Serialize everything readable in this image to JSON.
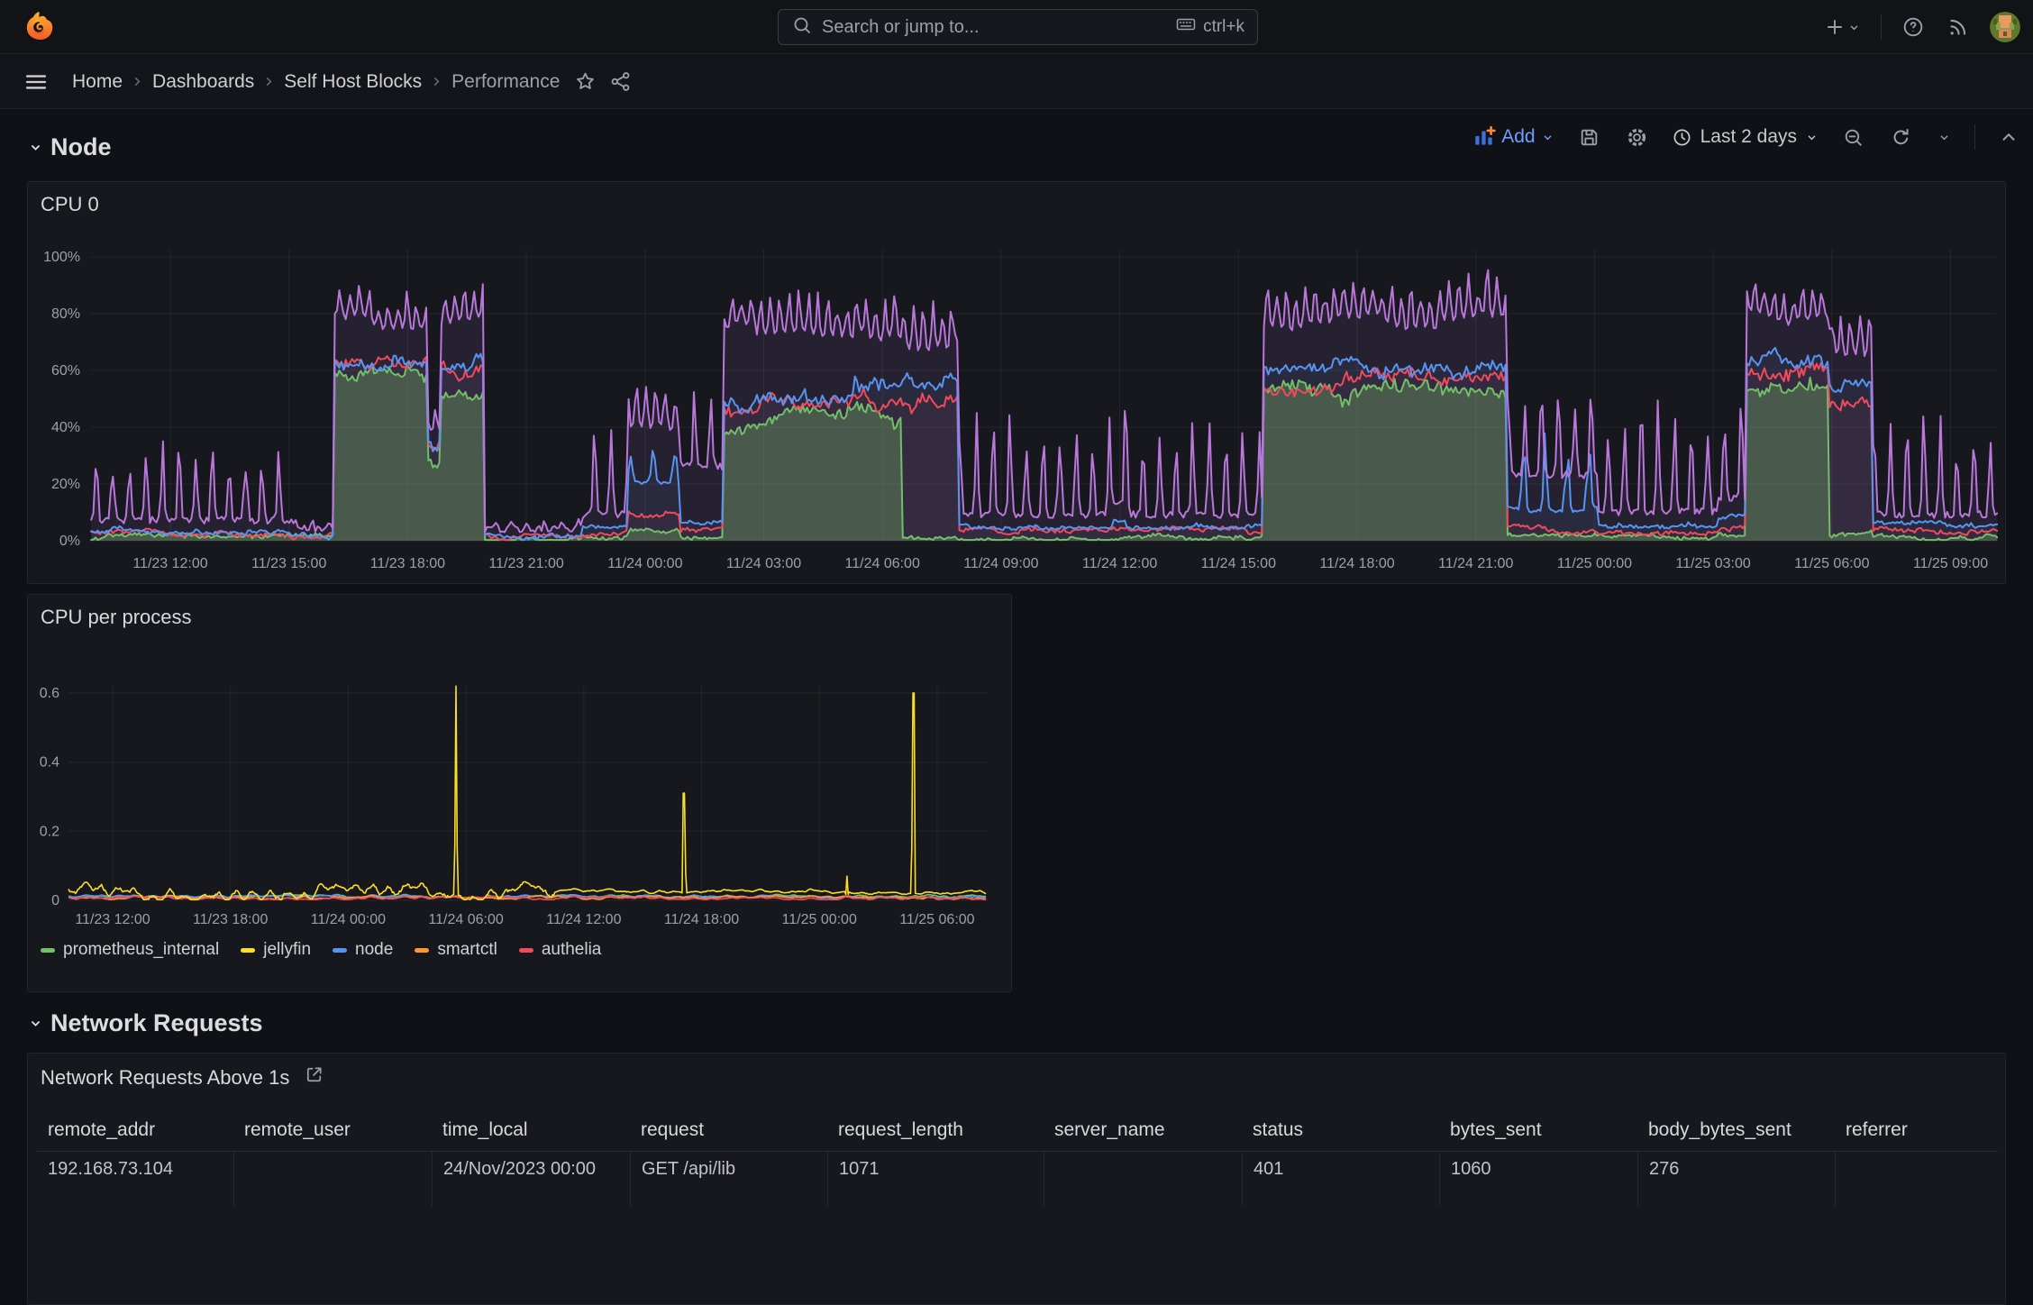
{
  "topbar": {
    "search": {
      "placeholder": "Search or jump to...",
      "shortcut": "ctrl+k"
    }
  },
  "breadcrumbs": {
    "items": [
      "Home",
      "Dashboards",
      "Self Host Blocks",
      "Performance"
    ]
  },
  "toolbar": {
    "add_label": "Add",
    "time_range": "Last 2 days"
  },
  "sections": [
    {
      "title": "Node"
    },
    {
      "title": "Network Requests"
    }
  ],
  "panels": {
    "cpu0": {
      "title": "CPU 0",
      "chart_data": {
        "type": "area",
        "unit": "percent",
        "ylim": [
          0,
          100
        ],
        "yticks": [
          "0%",
          "20%",
          "40%",
          "60%",
          "80%",
          "100%"
        ],
        "xticks": [
          "11/23 12:00",
          "11/23 15:00",
          "11/23 18:00",
          "11/23 21:00",
          "11/24 00:00",
          "11/24 03:00",
          "11/24 06:00",
          "11/24 09:00",
          "11/24 12:00",
          "11/24 15:00",
          "11/24 18:00",
          "11/24 21:00",
          "11/25 00:00",
          "11/25 03:00",
          "11/25 06:00",
          "11/25 09:00"
        ],
        "series_colors": {
          "green": "#73BF69",
          "red": "#F2495C",
          "blue": "#5794F2",
          "purple": "#B877D9"
        },
        "segments": [
          {
            "t": [
              -0.6,
              4.6
            ],
            "v": {
              "green": 1,
              "red": 2.5,
              "blue": 3.5,
              "purple": 6
            },
            "spike": 36
          },
          {
            "t": [
              4.6,
              5.65
            ],
            "v": {
              "green": 1,
              "red": 1.5,
              "blue": 2,
              "purple": 3
            },
            "spike": 6
          },
          {
            "t": [
              5.65,
              8.0
            ],
            "v": {
              "green": 57,
              "red": 60,
              "blue": 65,
              "purple": 77
            },
            "spike": 89
          },
          {
            "t": [
              8.0,
              8.35
            ],
            "v": {
              "green": 28,
              "red": 31,
              "blue": 34,
              "purple": 42
            },
            "spike": 50
          },
          {
            "t": [
              8.35,
              9.45
            ],
            "v": {
              "green": 54,
              "red": 58,
              "blue": 63,
              "purple": 79
            },
            "spike": 91
          },
          {
            "t": [
              9.45,
              11.9
            ],
            "v": {
              "green": 1,
              "red": 1.5,
              "blue": 2,
              "purple": 3
            },
            "spike": 6
          },
          {
            "t": [
              11.9,
              13.05
            ],
            "v": {
              "green": 2,
              "red": 3,
              "blue": 5,
              "purple": 8
            },
            "spike": 44
          },
          {
            "t": [
              13.05,
              14.4
            ],
            "v": {
              "green": 4,
              "red": 10,
              "blue": 20,
              "purple": 40
            },
            "spike": 58,
            "bs": 35
          },
          {
            "t": [
              14.4,
              15.5
            ],
            "v": {
              "green": 2,
              "red": 4,
              "blue": 7,
              "purple": 25
            },
            "spike": 56
          },
          {
            "t": [
              15.5,
              16.3
            ],
            "v": {
              "green": 42,
              "red": 45,
              "blue": 50,
              "purple": 77
            },
            "spike": 87
          },
          {
            "t": [
              16.3,
              18.8
            ],
            "v": {
              "green": 43,
              "red": 47,
              "blue": 53,
              "purple": 72
            },
            "spike": 88
          },
          {
            "t": [
              18.8,
              20.0
            ],
            "v": {
              "green": 44,
              "red": 50,
              "blue": 57,
              "purple": 73
            },
            "spike": 89
          },
          {
            "t": [
              20.0,
              21.4
            ],
            "v": {
              "green": 2,
              "red": 50,
              "blue": 58,
              "purple": 70
            },
            "spike": 88
          },
          {
            "t": [
              21.4,
              25.3
            ],
            "v": {
              "green": 1,
              "red": 3.5,
              "blue": 5.5,
              "purple": 8
            },
            "spike": 46
          },
          {
            "t": [
              25.3,
              25.65
            ],
            "v": {
              "green": 1,
              "red": 4,
              "blue": 7,
              "purple": 12
            },
            "spike": 80
          },
          {
            "t": [
              25.65,
              29.1
            ],
            "v": {
              "green": 1,
              "red": 3.5,
              "blue": 5.5,
              "purple": 8
            },
            "spike": 44
          },
          {
            "t": [
              29.1,
              33.6
            ],
            "v": {
              "green": 52,
              "red": 56,
              "blue": 62,
              "purple": 77
            },
            "spike": 93
          },
          {
            "t": [
              33.6,
              35.3
            ],
            "v": {
              "green": 50,
              "red": 55,
              "blue": 61,
              "purple": 79
            },
            "spike": 96
          },
          {
            "t": [
              35.3,
              37.6
            ],
            "v": {
              "green": 1,
              "red": 4,
              "blue": 12,
              "purple": 22
            },
            "spike": 58,
            "bs": 40
          },
          {
            "t": [
              37.6,
              40.6
            ],
            "v": {
              "green": 1,
              "red": 3.5,
              "blue": 6,
              "purple": 9
            },
            "spike": 50
          },
          {
            "t": [
              40.6,
              41.3
            ],
            "v": {
              "green": 2,
              "red": 5,
              "blue": 9,
              "purple": 14
            },
            "spike": 54
          },
          {
            "t": [
              41.3,
              43.4
            ],
            "v": {
              "green": 55,
              "red": 58,
              "blue": 63,
              "purple": 79
            },
            "spike": 92
          },
          {
            "t": [
              43.4,
              44.5
            ],
            "v": {
              "green": 2,
              "red": 46,
              "blue": 54,
              "purple": 68
            },
            "spike": 85
          },
          {
            "t": [
              44.5,
              48.3
            ],
            "v": {
              "green": 1,
              "red": 3.5,
              "blue": 5.5,
              "purple": 8
            },
            "spike": 48
          }
        ]
      }
    },
    "cpu_per_process": {
      "title": "CPU per process",
      "chart_data": {
        "type": "line",
        "ylim": [
          0,
          0.65
        ],
        "yticks": [
          "0",
          "0.2",
          "0.4",
          "0.6"
        ],
        "xticks": [
          "11/23 12:00",
          "11/23 18:00",
          "11/24 00:00",
          "11/24 06:00",
          "11/24 12:00",
          "11/24 18:00",
          "11/25 00:00",
          "11/25 06:00"
        ],
        "series": [
          {
            "name": "prometheus_internal",
            "color": "#73BF69",
            "base": 0.012
          },
          {
            "name": "jellyfin",
            "color": "#FADE2A",
            "base": 0.025,
            "wiggle": [
              {
                "t": [
                  -0.8,
                  24
                ],
                "amp": 0.018
              },
              {
                "t": [
                  24,
                  46
                ],
                "amp": 0.005
              }
            ],
            "spikes": [
              {
                "t": 19.0,
                "v": 0.62
              },
              {
                "t": 30.6,
                "v": 0.31
              },
              {
                "t": 38.9,
                "v": 0.07
              },
              {
                "t": 42.3,
                "v": 0.6
              }
            ]
          },
          {
            "name": "node",
            "color": "#5794F2",
            "base": 0.01
          },
          {
            "name": "smartctl",
            "color": "#FF9830",
            "base": 0.008
          },
          {
            "name": "authelia",
            "color": "#F2495C",
            "base": 0.006
          }
        ]
      }
    },
    "network_table": {
      "title": "Network Requests Above 1s",
      "columns": [
        "remote_addr",
        "remote_user",
        "time_local",
        "request",
        "request_length",
        "server_name",
        "status",
        "bytes_sent",
        "body_bytes_sent",
        "referrer"
      ],
      "partial_row": [
        "192.168.73.104",
        "",
        "24/Nov/2023 00:00",
        "GET /api/lib",
        "1071",
        "",
        "401",
        "1060",
        "276",
        ""
      ]
    }
  }
}
